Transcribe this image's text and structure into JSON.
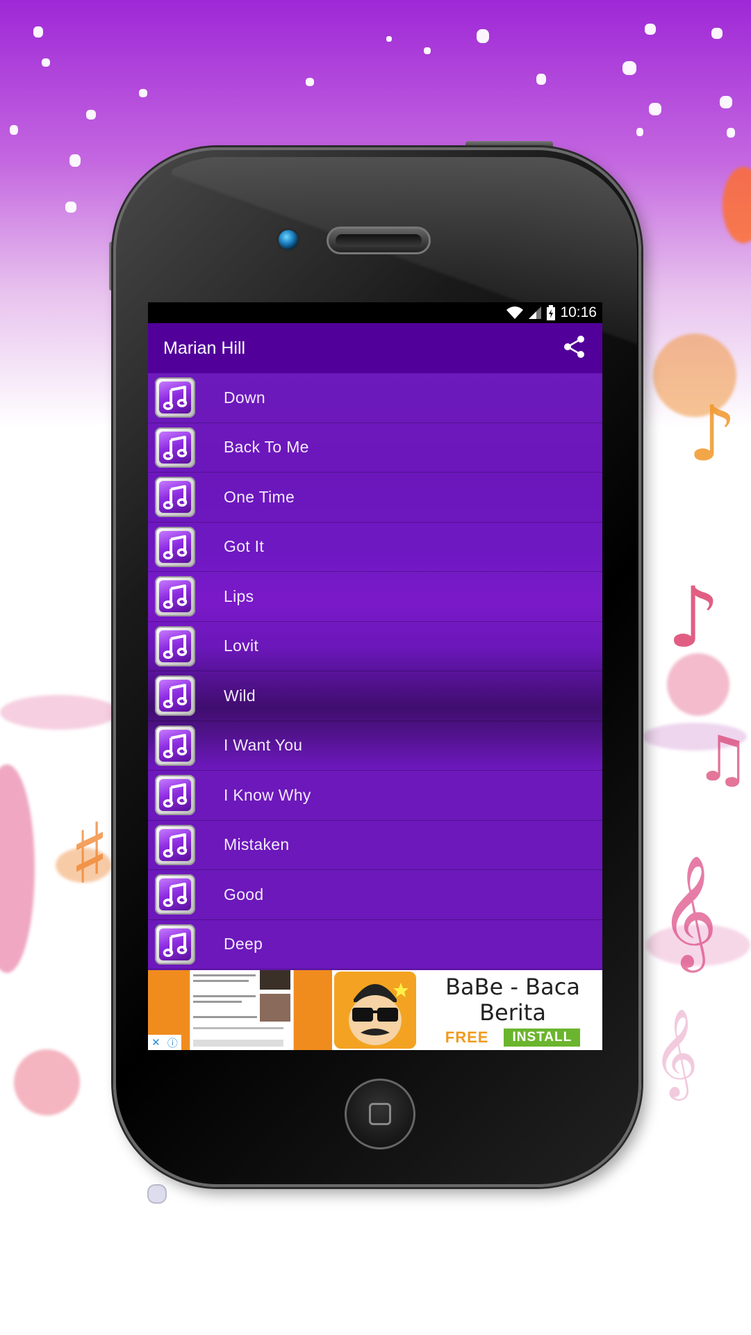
{
  "status_bar": {
    "time": "10:16"
  },
  "app_bar": {
    "title": "Marian Hill",
    "share_icon": "share-icon"
  },
  "songs": [
    {
      "title": "Down"
    },
    {
      "title": "Back To Me"
    },
    {
      "title": "One Time"
    },
    {
      "title": "Got It"
    },
    {
      "title": "Lips"
    },
    {
      "title": "Lovit"
    },
    {
      "title": "Wild"
    },
    {
      "title": "I Want You"
    },
    {
      "title": "I Know Why"
    },
    {
      "title": "Mistaken"
    },
    {
      "title": "Good"
    },
    {
      "title": "Deep"
    }
  ],
  "ad": {
    "app_name": "BaBe - Baca Berita",
    "price": "FREE",
    "install_label": "INSTALL",
    "close_glyph": "✕",
    "info_glyph": "ⓘ"
  },
  "colors": {
    "app_bar": "#51009a",
    "list_row": "#6a18b8",
    "install_button": "#6bb52e",
    "free_text": "#f09a1e"
  }
}
